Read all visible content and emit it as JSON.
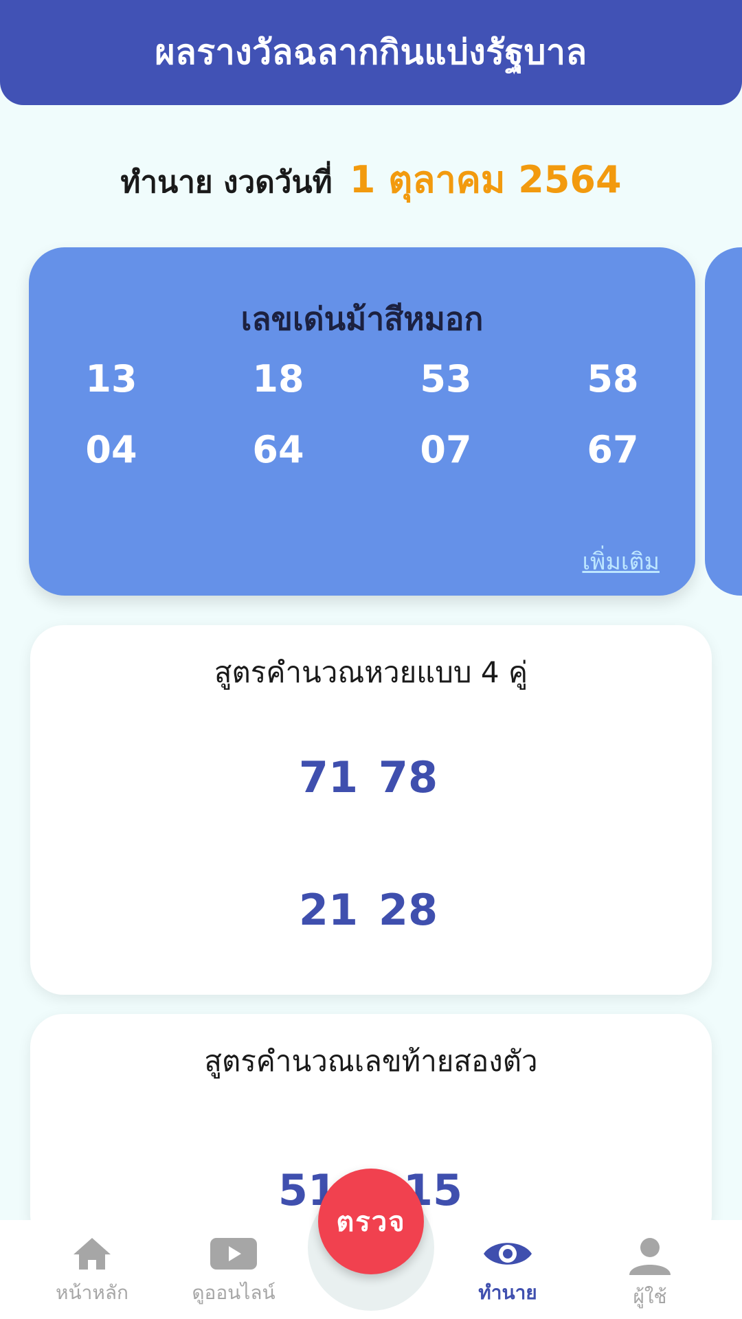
{
  "header": {
    "title": "ผลรางวัลฉลากกินแบ่งรัฐบาล"
  },
  "date_line": {
    "prefix": "ทำนาย งวดวันที่",
    "date": "1 ตุลาคม 2564"
  },
  "featured_card": {
    "title": "เลขเด่นม้าสีหมอก",
    "numbers": [
      [
        "13",
        "18",
        "53",
        "58"
      ],
      [
        "04",
        "64",
        "07",
        "67"
      ]
    ],
    "more_label": "เพิ่มเติม"
  },
  "card_four_pairs": {
    "title": "สูตรคำนวณหวยแบบ 4 คู่",
    "rows": [
      [
        "71",
        "78"
      ],
      [
        "21",
        "28"
      ]
    ]
  },
  "card_two_digits": {
    "title": "สูตรคำนวณเลขท้ายสองตัว",
    "rows": [
      [
        "51",
        "15"
      ]
    ]
  },
  "check_button": {
    "label": "ตรวจ"
  },
  "bottom_nav": [
    {
      "label": "หน้าหลัก",
      "icon": "home-icon",
      "active": false
    },
    {
      "label": "ดูออนไลน์",
      "icon": "play-icon",
      "active": false
    },
    {
      "label": "ทำนาย",
      "icon": "eye-icon",
      "active": true
    },
    {
      "label": "ผู้ใช้",
      "icon": "user-icon",
      "active": false
    }
  ],
  "colors": {
    "header": "#4152b5",
    "featured_card": "#6591e8",
    "accent_date": "#f29a0e",
    "number_text": "#3f4fae",
    "check_button": "#f1414f"
  }
}
